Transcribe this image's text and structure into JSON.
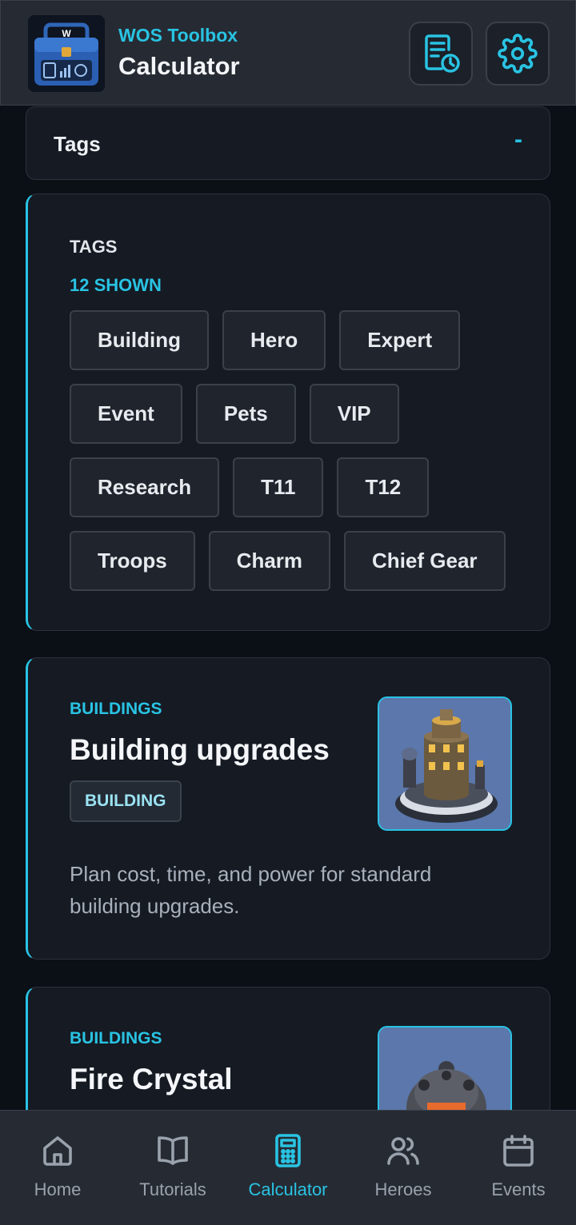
{
  "header": {
    "app_name": "WOS Toolbox",
    "page_title": "Calculator",
    "logo_letter": "W",
    "icons": {
      "history": "history-list-icon",
      "settings": "gear-icon"
    }
  },
  "tags_section": {
    "toggle_label": "Tags",
    "toggle_symbol": "-",
    "panel_title": "TAGS",
    "count_label": "12 SHOWN",
    "tags": [
      "Building",
      "Hero",
      "Expert",
      "Event",
      "Pets",
      "VIP",
      "Research",
      "T11",
      "T12",
      "Troops",
      "Charm",
      "Chief Gear"
    ]
  },
  "calculators": [
    {
      "category": "BUILDINGS",
      "title": "Building upgrades",
      "badge": "BUILDING",
      "description": "Plan cost, time, and power for standard building upgrades."
    },
    {
      "category": "BUILDINGS",
      "title": "Fire Crystal"
    }
  ],
  "bottom_nav": {
    "items": [
      {
        "label": "Home",
        "icon": "home-icon"
      },
      {
        "label": "Tutorials",
        "icon": "book-icon"
      },
      {
        "label": "Calculator",
        "icon": "calculator-icon"
      },
      {
        "label": "Heroes",
        "icon": "users-icon"
      },
      {
        "label": "Events",
        "icon": "calendar-icon"
      }
    ],
    "active": "Calculator"
  },
  "colors": {
    "accent": "#29c3e3",
    "background": "#0b0f16",
    "card": "#151a23",
    "bar": "#262b33"
  }
}
